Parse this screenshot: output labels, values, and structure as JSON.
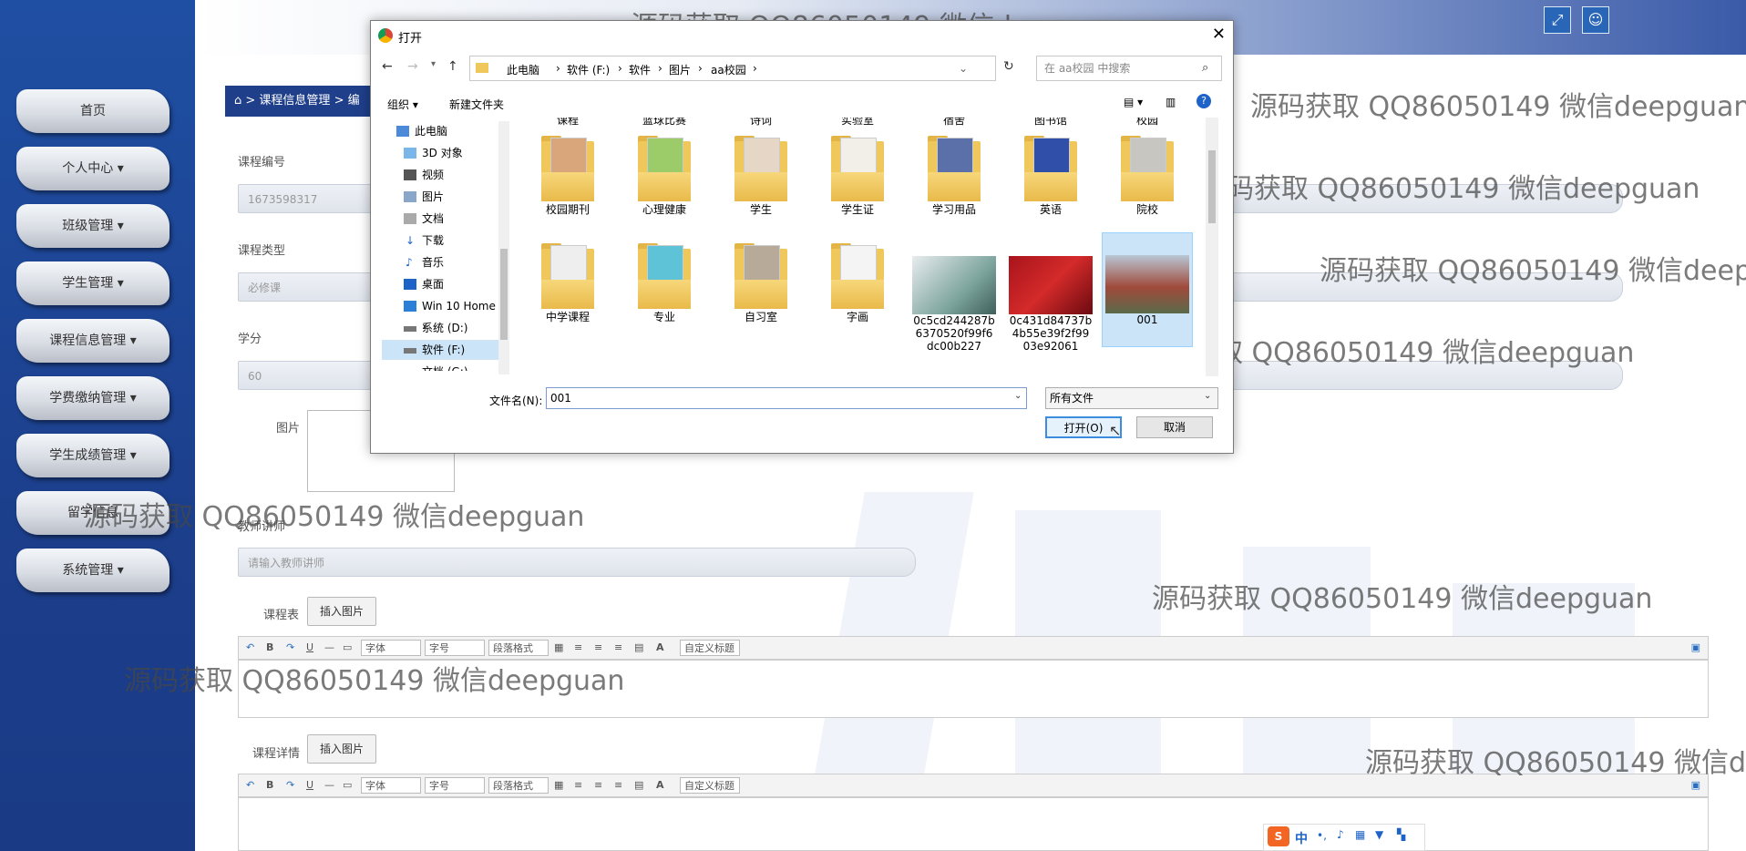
{
  "sidebar": {
    "items": [
      {
        "label": "首页"
      },
      {
        "label": "个人中心 ▾"
      },
      {
        "label": "班级管理 ▾"
      },
      {
        "label": "学生管理 ▾"
      },
      {
        "label": "课程信息管理 ▾"
      },
      {
        "label": "学费缴纳管理 ▾"
      },
      {
        "label": "学生成绩管理 ▾"
      },
      {
        "label": "留学信息"
      },
      {
        "label": "系统管理 ▾"
      }
    ]
  },
  "header": {
    "breadcrumb_text": "> 课程信息管理 > 编",
    "fullscreen_icon": "expand-icon",
    "user_icon": "user-icon"
  },
  "form": {
    "course_no_label": "课程编号",
    "course_no_value": "1673598317",
    "course_type_label": "课程类型",
    "course_type_value": "必修课",
    "credit_label": "学分",
    "credit_value": "60",
    "image_label": "图片",
    "teacher_label": "教师讲师",
    "teacher_placeholder": "请输入教师讲师",
    "schedule_label": "课程表",
    "details_label": "课程详情",
    "insert_image": "插入图片"
  },
  "editor": {
    "font": "字体",
    "size": "字号",
    "paragraph": "段落格式",
    "custom_title": "自定义标题",
    "bold": "B",
    "underline": "U",
    "font_color": "A"
  },
  "dialog": {
    "title": "打开",
    "path": [
      "此电脑",
      "软件 (F:)",
      "软件",
      "图片",
      "aa校园"
    ],
    "search_placeholder": "在 aa校园 中搜索",
    "organize": "组织 ▾",
    "new_folder": "新建文件夹",
    "tree": [
      "此电脑",
      "3D 对象",
      "视频",
      "图片",
      "文档",
      "下载",
      "音乐",
      "桌面",
      "Win 10 Home ›",
      "系统 (D:)",
      "软件 (F:)",
      "文档 (G:)"
    ],
    "top_row_partial": [
      "课程",
      "篮球比赛",
      "诗词",
      "实验室",
      "宿舍",
      "图书馆",
      "校园"
    ],
    "row1": [
      "校园期刊",
      "心理健康",
      "学生",
      "学生证",
      "学习用品",
      "英语",
      "院校"
    ],
    "row2": [
      "中学课程",
      "专业",
      "自习室",
      "字画",
      "0c5cd244287b6370520f99f6dc00b227",
      "0c431d84737b4b55e39f2f9903e92061",
      "001"
    ],
    "filename_label": "文件名(N):",
    "filename_value": "001",
    "filetype": "所有文件",
    "open_btn": "打开(O)",
    "cancel_btn": "取消"
  },
  "watermark": "源码获取 QQ86050149 微信deepguan",
  "ime": {
    "label": "中"
  }
}
